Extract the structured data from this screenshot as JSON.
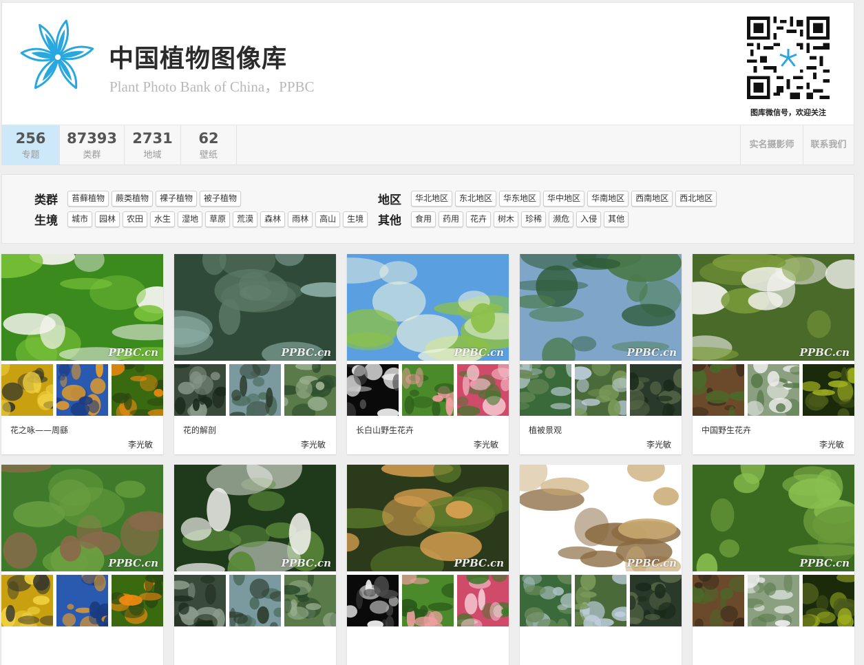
{
  "site": {
    "title": "中国植物图像库",
    "subtitle": "Plant Photo Bank of China，PPBC",
    "qr_caption": "图库微信号，欢迎关注",
    "brand_color": "#29a8e0"
  },
  "stats": [
    {
      "num": "256",
      "label": "专题"
    },
    {
      "num": "87393",
      "label": "类群"
    },
    {
      "num": "2731",
      "label": "地域"
    },
    {
      "num": "62",
      "label": "壁纸"
    }
  ],
  "nav_right": {
    "photographers": "实名摄影师",
    "contact": "联系我们"
  },
  "filters": {
    "taxa": {
      "label": "类群",
      "items": [
        "苔藓植物",
        "蕨类植物",
        "裸子植物",
        "被子植物"
      ]
    },
    "habitat": {
      "label": "生境",
      "items": [
        "城市",
        "园林",
        "农田",
        "水生",
        "湿地",
        "草原",
        "荒漠",
        "森林",
        "雨林",
        "高山",
        "生境"
      ]
    },
    "region": {
      "label": "地区",
      "items": [
        "华北地区",
        "东北地区",
        "华东地区",
        "华中地区",
        "华南地区",
        "西南地区",
        "西北地区"
      ]
    },
    "other": {
      "label": "其他",
      "items": [
        "食用",
        "药用",
        "花卉",
        "树木",
        "珍稀",
        "濒危",
        "入侵",
        "其他"
      ]
    }
  },
  "watermark": "PPBC.cn",
  "cards": [
    {
      "title": "花之咏——周繇",
      "author": "李光敏"
    },
    {
      "title": "花的解剖",
      "author": "李光敏"
    },
    {
      "title": "长白山野生花卉",
      "author": "李光敏"
    },
    {
      "title": "植被景观",
      "author": "李光敏"
    },
    {
      "title": "中国野生花卉",
      "author": "李光敏"
    },
    {
      "title": "",
      "author": ""
    },
    {
      "title": "",
      "author": ""
    },
    {
      "title": "",
      "author": ""
    },
    {
      "title": "",
      "author": ""
    },
    {
      "title": "",
      "author": ""
    }
  ]
}
